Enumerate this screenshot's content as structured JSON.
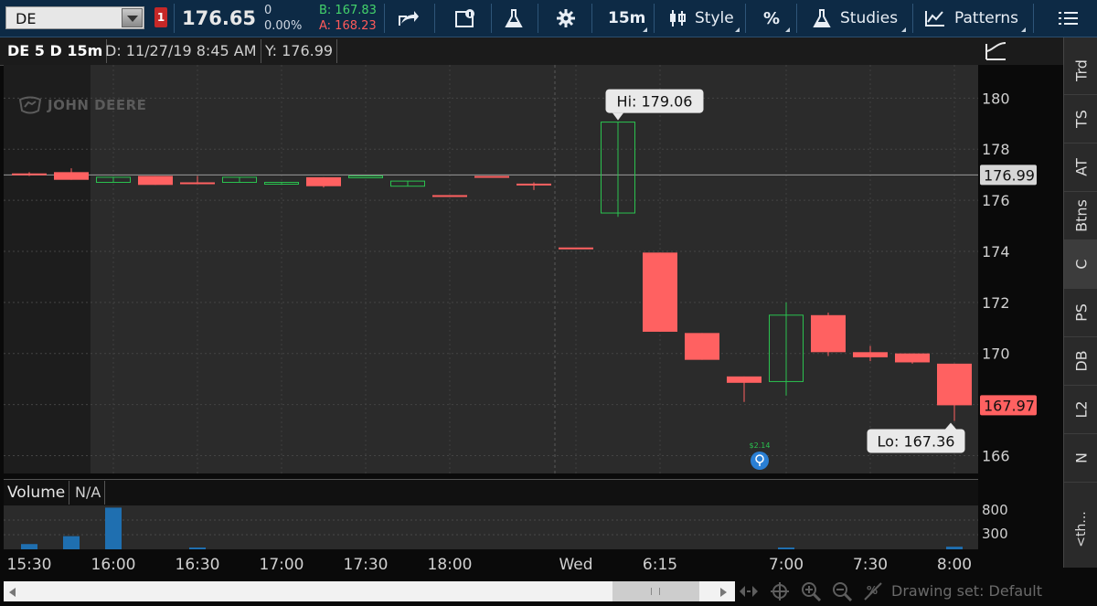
{
  "toolbar": {
    "symbol": "DE",
    "last_price": "176.65",
    "net_change": "0",
    "pct_change": "0.00%",
    "bid": "B: 167.83",
    "ask": "A: 168.23",
    "interval": "15m",
    "style_label": "Style",
    "studies_label": "Studies",
    "patterns_label": "Patterns"
  },
  "header": {
    "chart_title": "DE 5 D 15m",
    "date_readout": "D: 11/27/19 8:45 AM",
    "y_readout": "Y: 176.99"
  },
  "watermark": "JOHN DEERE",
  "side_tabs": [
    "Trd",
    "TS",
    "AT",
    "Btns",
    "C",
    "PS",
    "DB",
    "L2",
    "N"
  ],
  "side_tab_active": "C",
  "side_more": "<th...",
  "volume": {
    "label": "Volume",
    "value": "N/A",
    "ticks": [
      "800",
      "300"
    ]
  },
  "scroll": {
    "drawing_set": "Drawing set: Default"
  },
  "colors": {
    "up": "#2bc24f",
    "down": "#ff6161",
    "crosshair": "#9a9a9a",
    "volume": "#1f6fb0",
    "badge_blue": "#2a7fd4"
  },
  "chart_data": {
    "type": "candlestick",
    "ylim": [
      165.3,
      181.3
    ],
    "yticks": [
      180,
      178,
      176,
      174,
      172,
      170,
      168,
      166
    ],
    "x_labels": [
      {
        "slot": 0,
        "text": "15:30"
      },
      {
        "slot": 2,
        "text": "16:00"
      },
      {
        "slot": 4,
        "text": "16:30"
      },
      {
        "slot": 6,
        "text": "17:00"
      },
      {
        "slot": 8,
        "text": "17:30"
      },
      {
        "slot": 10,
        "text": "18:00"
      },
      {
        "slot": 13,
        "text": "Wed"
      },
      {
        "slot": 15,
        "text": "6:15"
      },
      {
        "slot": 18,
        "text": "7:00"
      },
      {
        "slot": 20,
        "text": "7:30"
      },
      {
        "slot": 22,
        "text": "8:00"
      }
    ],
    "candles": [
      {
        "slot": 0,
        "o": 177.05,
        "h": 177.1,
        "l": 176.95,
        "c": 177.0
      },
      {
        "slot": 1,
        "o": 177.1,
        "h": 177.25,
        "l": 176.8,
        "c": 176.8
      },
      {
        "slot": 2,
        "o": 176.7,
        "h": 176.9,
        "l": 176.7,
        "c": 176.9
      },
      {
        "slot": 3,
        "o": 176.95,
        "h": 176.95,
        "l": 176.6,
        "c": 176.6
      },
      {
        "slot": 4,
        "o": 176.7,
        "h": 176.95,
        "l": 176.65,
        "c": 176.7
      },
      {
        "slot": 5,
        "o": 176.7,
        "h": 176.9,
        "l": 176.7,
        "c": 176.9
      },
      {
        "slot": 6,
        "o": 176.65,
        "h": 176.7,
        "l": 176.65,
        "c": 176.7
      },
      {
        "slot": 7,
        "o": 176.9,
        "h": 176.9,
        "l": 176.5,
        "c": 176.55
      },
      {
        "slot": 8,
        "o": 176.9,
        "h": 176.9,
        "l": 176.9,
        "c": 176.95
      },
      {
        "slot": 9,
        "o": 176.55,
        "h": 176.75,
        "l": 176.55,
        "c": 176.75
      },
      {
        "slot": 10,
        "o": 176.2,
        "h": 176.2,
        "l": 176.2,
        "c": 176.2
      },
      {
        "slot": 11,
        "o": 176.95,
        "h": 176.95,
        "l": 176.95,
        "c": 176.95
      },
      {
        "slot": 12,
        "o": 176.65,
        "h": 176.7,
        "l": 176.4,
        "c": 176.6
      },
      {
        "slot": 13,
        "o": 174.15,
        "h": 174.15,
        "l": 174.15,
        "c": 174.15
      },
      {
        "slot": 14,
        "o": 175.5,
        "h": 179.06,
        "l": 175.35,
        "c": 179.06
      },
      {
        "slot": 15,
        "o": 173.95,
        "h": 173.95,
        "l": 170.85,
        "c": 170.85
      },
      {
        "slot": 16,
        "o": 170.8,
        "h": 170.8,
        "l": 169.75,
        "c": 169.75
      },
      {
        "slot": 17,
        "o": 169.1,
        "h": 169.1,
        "l": 168.1,
        "c": 168.85
      },
      {
        "slot": 18,
        "o": 168.9,
        "h": 172.0,
        "l": 168.35,
        "c": 171.5
      },
      {
        "slot": 19,
        "o": 171.5,
        "h": 171.6,
        "l": 169.9,
        "c": 170.05
      },
      {
        "slot": 20,
        "o": 170.05,
        "h": 170.3,
        "l": 169.7,
        "c": 169.85
      },
      {
        "slot": 21,
        "o": 170.0,
        "h": 170.0,
        "l": 169.6,
        "c": 169.65
      },
      {
        "slot": 22,
        "o": 169.6,
        "h": 169.6,
        "l": 167.36,
        "c": 167.97
      }
    ],
    "volume": [
      {
        "slot": 0,
        "v": 120
      },
      {
        "slot": 1,
        "v": 300
      },
      {
        "slot": 2,
        "v": 950
      },
      {
        "slot": 4,
        "v": 30
      },
      {
        "slot": 18,
        "v": 20
      },
      {
        "slot": 22,
        "v": 60
      }
    ],
    "hi_label": "Hi: 179.06",
    "lo_label": "Lo: 167.36",
    "last_label": "167.97",
    "crosshair_label": "176.99",
    "crosshair_value": 176.99,
    "event_label": "$2.14"
  }
}
